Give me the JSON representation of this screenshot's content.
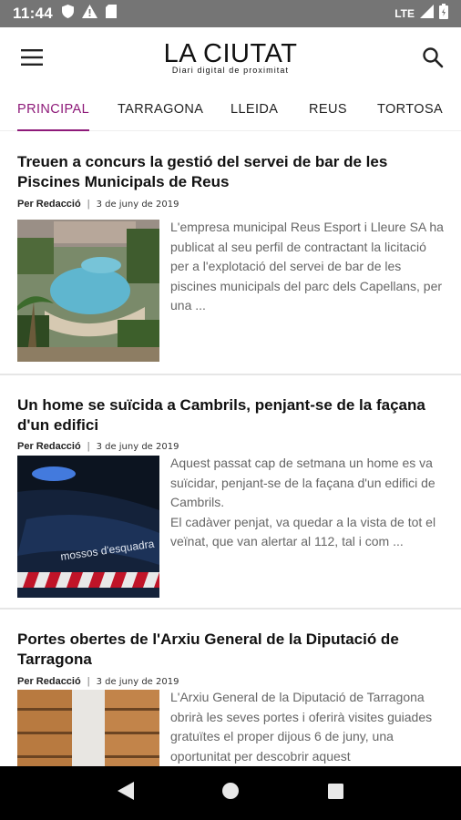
{
  "status_bar": {
    "time": "11:44",
    "network": "LTE",
    "icons": [
      "shield-icon",
      "warning-icon",
      "sim-card-icon",
      "signal-icon",
      "battery-icon"
    ]
  },
  "app_bar": {
    "logo_title": "LA CIUTAT",
    "logo_subtitle": "Diari digital de proximitat",
    "menu_icon": "hamburger-menu-icon",
    "search_icon": "search-icon"
  },
  "tabs": [
    {
      "label": "PRINCIPAL",
      "active": true
    },
    {
      "label": "TARRAGONA",
      "active": false
    },
    {
      "label": "LLEIDA",
      "active": false
    },
    {
      "label": "REUS",
      "active": false
    },
    {
      "label": "TORTOSA",
      "active": false
    }
  ],
  "accent_color": "#8e1a79",
  "articles": [
    {
      "title": "Treuen a concurs la gestió del servei de bar de les Piscines Municipals de Reus",
      "author": "Per Redacció",
      "date": "3 de juny de 2019",
      "excerpt": "L'empresa municipal Reus Esport i Lleure SA ha publicat al seu perfil de contractant la licitació per a l'explotació del servei de bar de les piscines municipals del parc dels Capellans, per una ..."
    },
    {
      "title": "Un home se suïcida a Cambrils, penjant-se de la façana d'un edifici",
      "author": "Per Redacció",
      "date": "3 de juny de 2019",
      "excerpt": "Aquest passat cap de setmana un home es va suïcidar, penjant-se de la façana d'un edifici de Cambrils.\nEl cadàver penjat, va quedar a la vista de tot el veïnat, que van alertar al 112, tal i com ...",
      "image_text": "mossos d'esquadra"
    },
    {
      "title": "Portes obertes de l'Arxiu General de la Diputació de Tarragona",
      "author": "Per Redacció",
      "date": "3 de juny de 2019",
      "excerpt": "L'Arxiu General de la Diputació de Tarragona obrirà les seves portes i oferirà visites guiades gratuïtes el proper dijous 6 de juny, una oportunitat per descobrir aquest"
    }
  ],
  "nav_bar": {
    "back_icon": "back-triangle-icon",
    "home_icon": "home-circle-icon",
    "recents_icon": "recents-square-icon"
  }
}
